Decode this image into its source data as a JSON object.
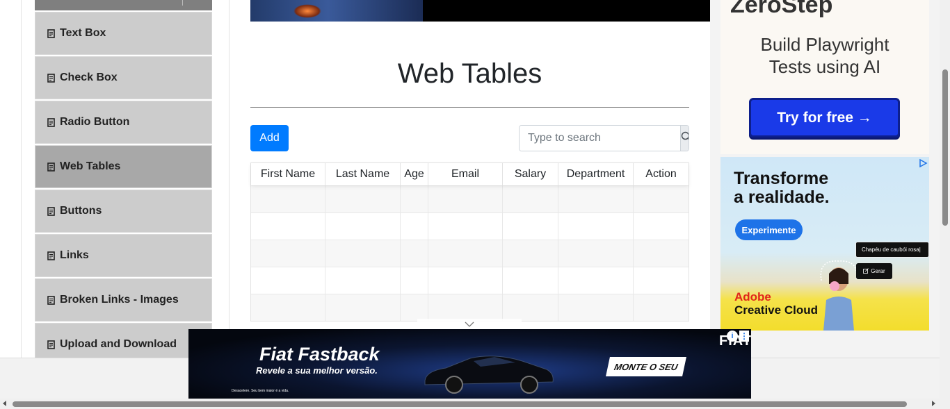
{
  "sidebar": {
    "items": [
      {
        "label": "Text Box",
        "active": false
      },
      {
        "label": "Check Box",
        "active": false
      },
      {
        "label": "Radio Button",
        "active": false
      },
      {
        "label": "Web Tables",
        "active": true
      },
      {
        "label": "Buttons",
        "active": false
      },
      {
        "label": "Links",
        "active": false
      },
      {
        "label": "Broken Links - Images",
        "active": false
      },
      {
        "label": "Upload and Download",
        "active": false
      }
    ]
  },
  "main": {
    "title": "Web Tables",
    "add_label": "Add",
    "search": {
      "placeholder": "Type to search",
      "value": ""
    },
    "table": {
      "columns": [
        "First Name",
        "Last Name",
        "Age",
        "Email",
        "Salary",
        "Department",
        "Action"
      ],
      "row_count": 5
    }
  },
  "ads": {
    "zerostep": {
      "logo": "ZeroStep",
      "headline_line1": "Build Playwright",
      "headline_line2": "Tests using AI",
      "cta": "Try for free →"
    },
    "adobe": {
      "title_line1": "Transforme",
      "title_line2": "a realidade.",
      "button": "Experimente",
      "prompt_chip": "Chapéu de caubói rosa|",
      "generate": "Gerar",
      "brand_line1": "Adobe",
      "brand_line2": "Creative Cloud"
    },
    "fiat": {
      "title": "Fiat Fastback",
      "subtitle": "Revele a sua melhor versão.",
      "cta": "MONTE O SEU",
      "fine_print": "Desacelere. Seu bem maior é a vida.",
      "logo": "FIAT"
    }
  },
  "colors": {
    "primary": "#007bff",
    "menu_bg": "#cccccc",
    "menu_active_bg": "#a8a8a8",
    "zerostep_cta": "#1a3ae8",
    "adobe_red": "#e1251b"
  }
}
